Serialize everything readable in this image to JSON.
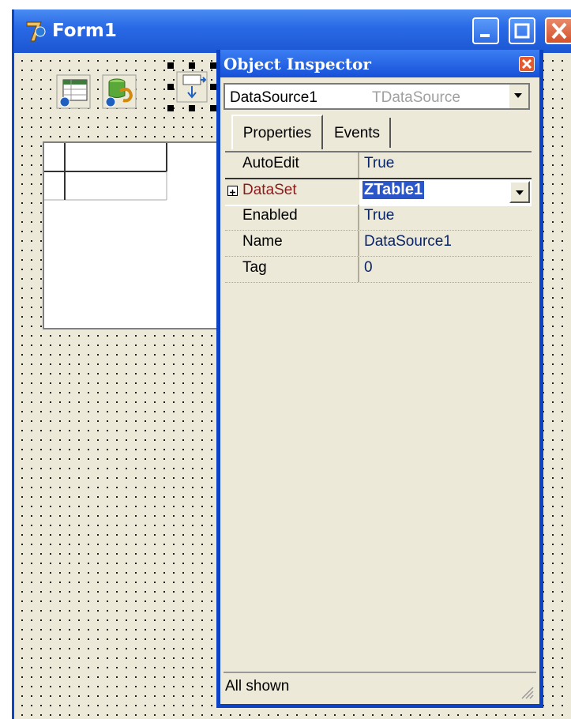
{
  "form": {
    "title": "Form1",
    "components": [
      "table-component-icon",
      "query-component-icon",
      "datasource-component-icon"
    ]
  },
  "object_inspector": {
    "title": "Object Inspector",
    "selected_component": {
      "name": "DataSource1",
      "type": "TDataSource"
    },
    "tabs": [
      {
        "label": "Properties",
        "active": true
      },
      {
        "label": "Events",
        "active": false
      }
    ],
    "properties": [
      {
        "name": "AutoEdit",
        "value": "True"
      },
      {
        "name": "DataSet",
        "value": "ZTable1"
      },
      {
        "name": "Enabled",
        "value": "True"
      },
      {
        "name": "Name",
        "value": "DataSource1"
      },
      {
        "name": "Tag",
        "value": "0"
      }
    ],
    "status": "All shown"
  },
  "colors": {
    "titlebar": "#1c56d2",
    "form_background": "#ece9d8",
    "selection": "#2a56c9",
    "property_link": "#8b1a1a"
  }
}
